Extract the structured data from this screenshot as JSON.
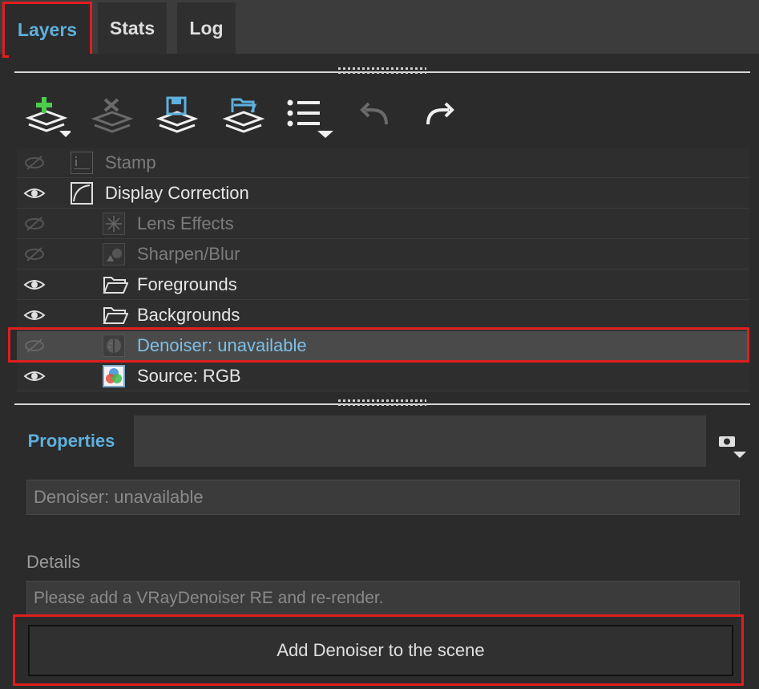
{
  "tabs": [
    {
      "label": "Layers",
      "active": true
    },
    {
      "label": "Stats",
      "active": false
    },
    {
      "label": "Log",
      "active": false
    }
  ],
  "toolbar": {
    "buttons": [
      {
        "icon": "add-layer-icon",
        "enabled": true
      },
      {
        "icon": "remove-layer-icon",
        "enabled": false
      },
      {
        "icon": "save-layers-icon",
        "enabled": true
      },
      {
        "icon": "open-layers-icon",
        "enabled": true
      },
      {
        "icon": "list-menu-icon",
        "enabled": true
      },
      {
        "icon": "undo-icon",
        "enabled": false
      },
      {
        "icon": "redo-icon",
        "enabled": true
      }
    ]
  },
  "layers": [
    {
      "label": "Stamp",
      "visible": false,
      "icon": "stamp-icon",
      "indent": 0,
      "state": "dim"
    },
    {
      "label": "Display Correction",
      "visible": true,
      "icon": "curve-icon",
      "indent": 0,
      "state": "bright"
    },
    {
      "label": "Lens Effects",
      "visible": false,
      "icon": "lens-effects-icon",
      "indent": 1,
      "state": "dim"
    },
    {
      "label": "Sharpen/Blur",
      "visible": false,
      "icon": "sharpen-blur-icon",
      "indent": 1,
      "state": "dim"
    },
    {
      "label": "Foregrounds",
      "visible": true,
      "icon": "folder-icon",
      "indent": 1,
      "state": "bright"
    },
    {
      "label": "Backgrounds",
      "visible": true,
      "icon": "folder-icon",
      "indent": 1,
      "state": "bright"
    },
    {
      "label": "Denoiser: unavailable",
      "visible": false,
      "icon": "denoiser-icon",
      "indent": 1,
      "state": "selected"
    },
    {
      "label": "Source: RGB",
      "visible": true,
      "icon": "rgb-source-icon",
      "indent": 1,
      "state": "bright"
    }
  ],
  "properties": {
    "tab_label": "Properties",
    "name_value": "Denoiser: unavailable",
    "details_label": "Details",
    "details_value": "Please add a VRayDenoiser RE and re-render.",
    "action_button_label": "Add Denoiser to the scene"
  },
  "colors": {
    "accent": "#5fb0dd",
    "highlight": "#e01e1e",
    "background": "#2b2b2b"
  }
}
